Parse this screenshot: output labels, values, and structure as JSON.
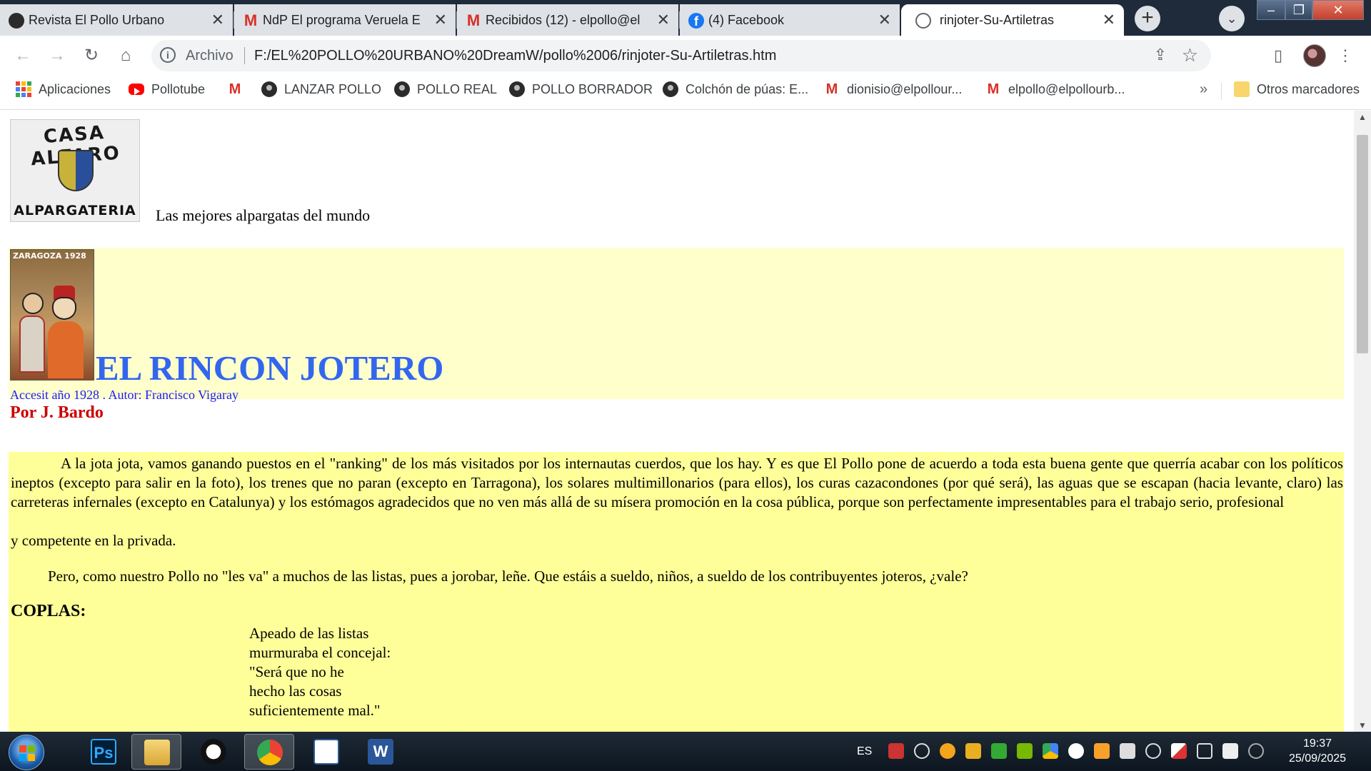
{
  "browser": {
    "tabs": [
      {
        "title": "Revista El Pollo Urbano",
        "active": false,
        "favicon": "dark-circle-icon"
      },
      {
        "title": "NdP El programa Veruela E",
        "active": false,
        "favicon": "gmail-icon"
      },
      {
        "title": "Recibidos (12) - elpollo@el",
        "active": false,
        "favicon": "gmail-icon"
      },
      {
        "title": "(4) Facebook",
        "active": false,
        "favicon": "facebook-icon"
      },
      {
        "title": "rinjoter-Su-Artiletras",
        "active": true,
        "favicon": "globe-icon"
      }
    ],
    "omnibox": {
      "scheme_label": "Archivo",
      "url": "F:/EL%20POLLO%20URBANO%20DreamW/pollo%2006/rinjoter-Su-Artiletras.htm"
    },
    "bookmarks": [
      {
        "label": "Aplicaciones",
        "icon": "apps-grid-icon"
      },
      {
        "label": "Pollotube",
        "icon": "youtube-icon"
      },
      {
        "label": "",
        "icon": "gmail-icon"
      },
      {
        "label": "LANZAR POLLO",
        "icon": "dark-circle-icon"
      },
      {
        "label": "POLLO REAL",
        "icon": "dark-circle-icon"
      },
      {
        "label": "POLLO BORRADOR",
        "icon": "dark-circle-icon"
      },
      {
        "label": "Colchón de púas: E...",
        "icon": "dark-circle-icon"
      },
      {
        "label": "dionisio@elpollour...",
        "icon": "gmail-icon"
      },
      {
        "label": "elpollo@elpollourb...",
        "icon": "gmail-icon"
      }
    ],
    "bookmarks_more": "»",
    "other_bookmarks": "Otros marcadores"
  },
  "page": {
    "logo": {
      "top_text": "CASA ALFARO",
      "bottom_text": "ALPARGATERIA"
    },
    "tagline": "Las mejores alpargatas del mundo",
    "poster_label": "ZARAGOZA 1928",
    "title": "EL RINCON JOTERO",
    "subtitle": "Accesit año 1928 . Autor: Francisco Vigaray",
    "byline": "Por J. Bardo",
    "para1": "A la jota jota, vamos ganando puestos en el \"ranking\" de los más visitados por los internautas cuerdos, que los hay. Y es que El Pollo pone de acuerdo a toda esta buena gente que querría acabar con los políticos ineptos (excepto para salir en la foto), los trenes que no paran (excepto en Tarragona), los solares multimillonarios (para ellos), los curas cazacondones (por qué será), las aguas que se escapan (hacia levante, claro)  las carreteras infernales (excepto en Catalunya) y los estómagos agradecidos que no ven más allá de su mísera promoción en la cosa pública, porque son perfectamente impresentables para el trabajo serio, profesional",
    "para1_tail": "y competente en la privada.",
    "para2": "Pero, como nuestro Pollo no \"les va\" a muchos de las listas, pues a jorobar, leñe. Que estáis a sueldo, niños, a sueldo de los contribuyentes joteros, ¿vale?",
    "coplas_heading": "COPLAS:",
    "verse": [
      "Apeado de las listas",
      "murmuraba el concejal:",
      "\"Será que no he",
      "hecho las cosas",
      "suficientemente mal.\""
    ]
  },
  "taskbar": {
    "apps": [
      {
        "name": "photoshop",
        "label": "Ps"
      },
      {
        "name": "explorer",
        "label": ""
      },
      {
        "name": "panda",
        "label": ""
      },
      {
        "name": "chrome",
        "label": ""
      },
      {
        "name": "calendar",
        "label": ""
      },
      {
        "name": "word",
        "label": "W"
      }
    ],
    "language": "ES",
    "time": "19:37",
    "date": "25/09/2025"
  },
  "colors": {
    "title_blue": "#3366ee",
    "byline_red": "#cc0000",
    "banner_bg": "#ffffcc",
    "article_bg": "#ffff99"
  }
}
